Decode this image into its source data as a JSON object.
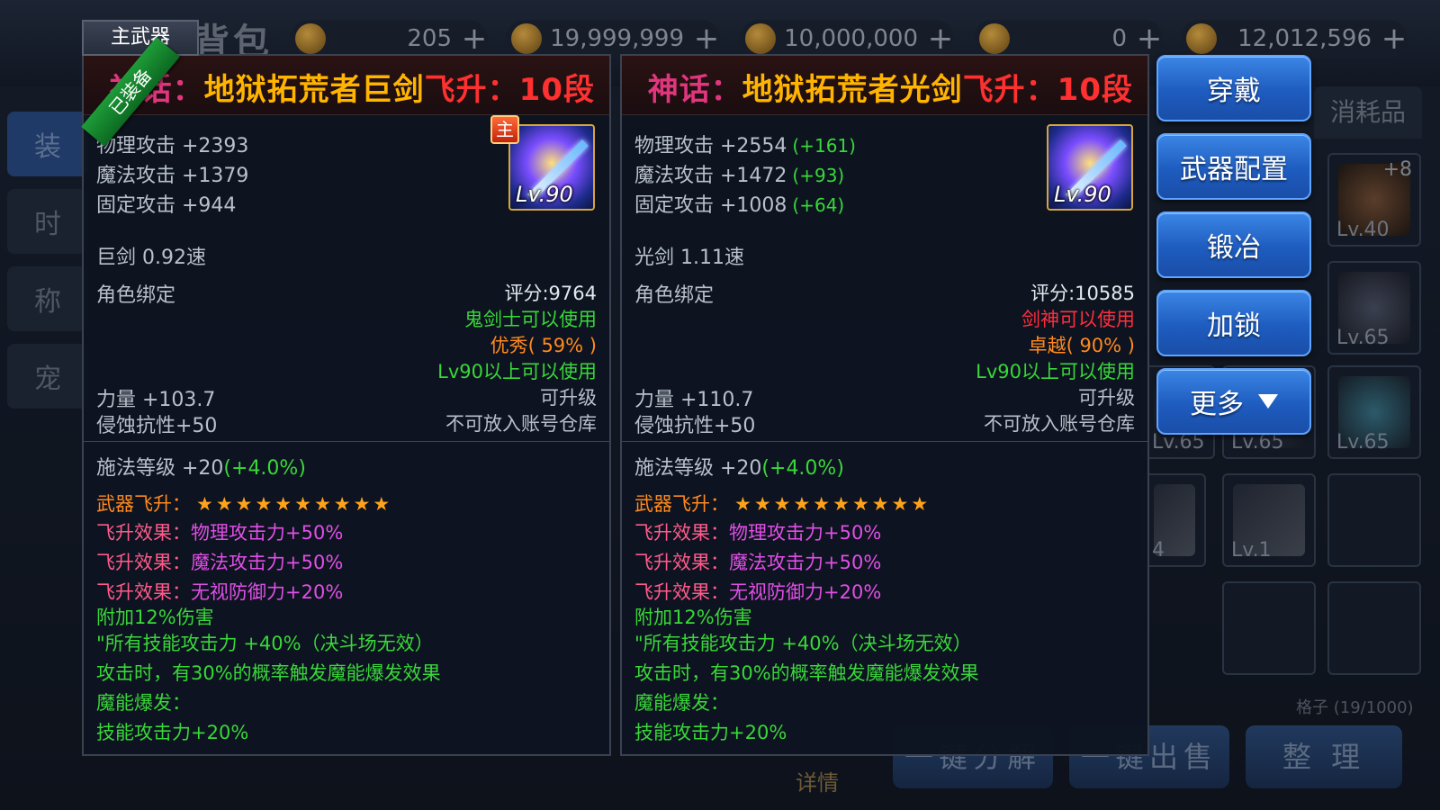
{
  "background": {
    "page_title": "背包",
    "currencies": [
      {
        "icon": "compass-coin-icon",
        "value": "205"
      },
      {
        "icon": "scroll-icon",
        "value": "19,999,999"
      },
      {
        "icon": "scroll-icon",
        "value": "10,000,000"
      },
      {
        "icon": "coin-icon",
        "value": "0"
      },
      {
        "icon": "gold-coin-icon",
        "value": "12,012,596"
      }
    ],
    "left_tabs": [
      "装",
      "时",
      "称",
      "宠"
    ],
    "right_tab": "消耗品",
    "slots": [
      {
        "level": "Lv.40",
        "badge": "+8"
      },
      {
        "level": "Lv.65"
      },
      {
        "level": "Lv.65"
      },
      {
        "level": "Lv.65"
      },
      {
        "level": "Lv.65"
      },
      {
        "level": "4"
      },
      {
        "level": "Lv.1"
      }
    ],
    "slot_count": "格子 (19/1000)",
    "bottom_buttons": [
      "一键分解",
      "一键出售",
      "整 理"
    ],
    "detail_link": "详情"
  },
  "top_tab": "主武器",
  "equipped_ribbon": "已装备",
  "actions": {
    "wear": "穿戴",
    "weapon_config": "武器配置",
    "forge": "锻冶",
    "lock": "加锁",
    "more": "更多"
  },
  "items": [
    {
      "rarity": "神话：",
      "name": "地狱拓荒者巨剑",
      "ascend": "飞升：10段",
      "main_badge": "主",
      "icon_level": "Lv.90",
      "stats": [
        {
          "label": "物理攻击 +2393",
          "diff": ""
        },
        {
          "label": "魔法攻击 +1379",
          "diff": ""
        },
        {
          "label": "固定攻击 +944",
          "diff": ""
        }
      ],
      "speed": "巨剑 0.92速",
      "bind": "角色绑定",
      "score": "评分:9764",
      "usable_by": "鬼剑士可以使用",
      "quality": "优秀( 59% )",
      "level_req": "Lv90以上可以使用",
      "str": "力量 +103.7",
      "upgradable": "可升级",
      "resist": "侵蚀抗性+50",
      "no_storage": "不可放入账号仓库",
      "cast_level": "施法等级 +20",
      "cast_bonus": "(+4.0%)",
      "ascend_label": "武器飞升：",
      "stars": "★★★★★★★★★★",
      "effects": [
        {
          "key": "飞升效果：",
          "val": "物理攻击力+50%"
        },
        {
          "key": "飞升效果：",
          "val": "魔法攻击力+50%"
        },
        {
          "key": "飞升效果：",
          "val": "无视防御力+20%"
        }
      ],
      "extras": [
        "附加12%伤害",
        "\"所有技能攻击力 +40%（决斗场无效）",
        "攻击时，有30%的概率触发魔能爆发效果",
        "魔能爆发：",
        "技能攻击力+20%"
      ]
    },
    {
      "rarity": "神话：",
      "name": "地狱拓荒者光剑",
      "ascend": "飞升：10段",
      "main_badge": "",
      "icon_level": "Lv.90",
      "stats": [
        {
          "label": "物理攻击 +2554",
          "diff": "(+161)"
        },
        {
          "label": "魔法攻击 +1472",
          "diff": "(+93)"
        },
        {
          "label": "固定攻击 +1008",
          "diff": "(+64)"
        }
      ],
      "speed": "光剑 1.11速",
      "bind": "角色绑定",
      "score": "评分:10585",
      "usable_by": "剑神可以使用",
      "quality": "卓越( 90% )",
      "level_req": "Lv90以上可以使用",
      "str": "力量 +110.7",
      "upgradable": "可升级",
      "resist": "侵蚀抗性+50",
      "no_storage": "不可放入账号仓库",
      "cast_level": "施法等级 +20",
      "cast_bonus": "(+4.0%)",
      "ascend_label": "武器飞升：",
      "stars": "★★★★★★★★★★",
      "effects": [
        {
          "key": "飞升效果：",
          "val": "物理攻击力+50%"
        },
        {
          "key": "飞升效果：",
          "val": "魔法攻击力+50%"
        },
        {
          "key": "飞升效果：",
          "val": "无视防御力+20%"
        }
      ],
      "extras": [
        "附加12%伤害",
        "\"所有技能攻击力 +40%（决斗场无效）",
        "攻击时，有30%的概率触发魔能爆发效果",
        "魔能爆发：",
        "技能攻击力+20%"
      ]
    }
  ]
}
